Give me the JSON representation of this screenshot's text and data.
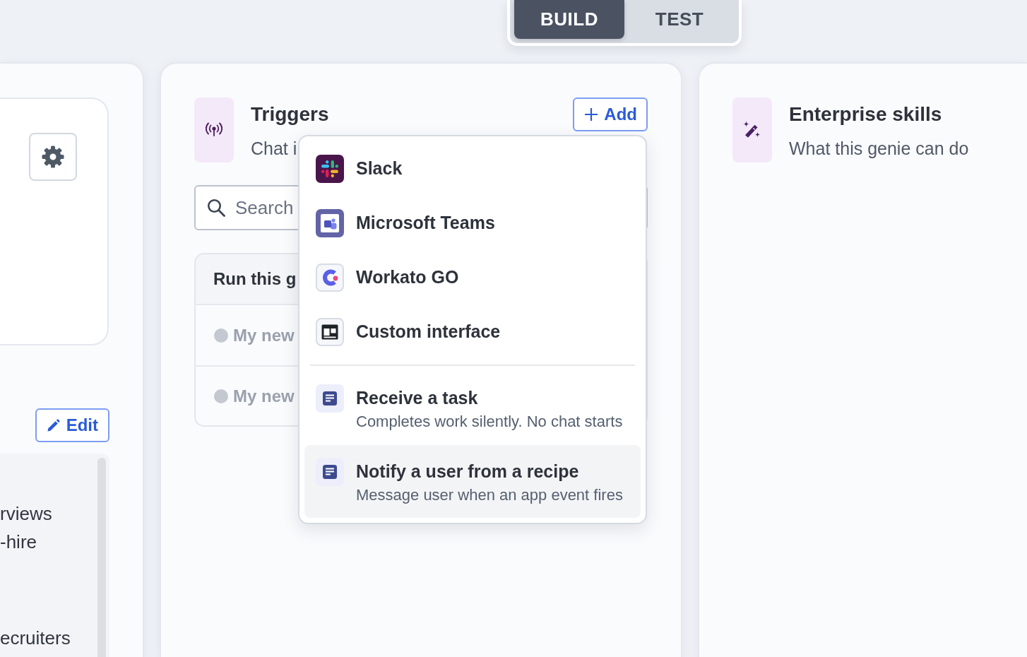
{
  "mode_toggle": {
    "tabs": [
      {
        "label": "BUILD",
        "selected": true
      },
      {
        "label": "TEST",
        "selected": false
      }
    ]
  },
  "left_panel": {
    "edit_button": "Edit",
    "description_paragraphs": [
      [
        "rviews",
        "-hire"
      ],
      [
        "ecruiters"
      ]
    ]
  },
  "triggers_panel": {
    "title": "Triggers",
    "subtitle": "Chat i",
    "add_button": "Add",
    "search": {
      "placeholder": "Search"
    },
    "table": {
      "header": "Run this g",
      "rows": [
        {
          "name": "My new",
          "active": false
        },
        {
          "name": "My new",
          "active": false
        }
      ]
    }
  },
  "add_menu": {
    "apps": [
      {
        "label": "Slack",
        "highlighted": false
      },
      {
        "label": "Microsoft Teams",
        "highlighted": false
      },
      {
        "label": "Workato GO",
        "highlighted": false
      },
      {
        "label": "Custom interface",
        "highlighted": false
      }
    ],
    "actions": [
      {
        "title": "Receive a task",
        "description": "Completes work silently. No chat starts",
        "highlighted": false
      },
      {
        "title": "Notify a user from a recipe",
        "description": "Message user when an app event fires",
        "highlighted": true
      }
    ]
  },
  "skills_panel": {
    "title": "Enterprise skills",
    "subtitle": "What this genie can do"
  }
}
